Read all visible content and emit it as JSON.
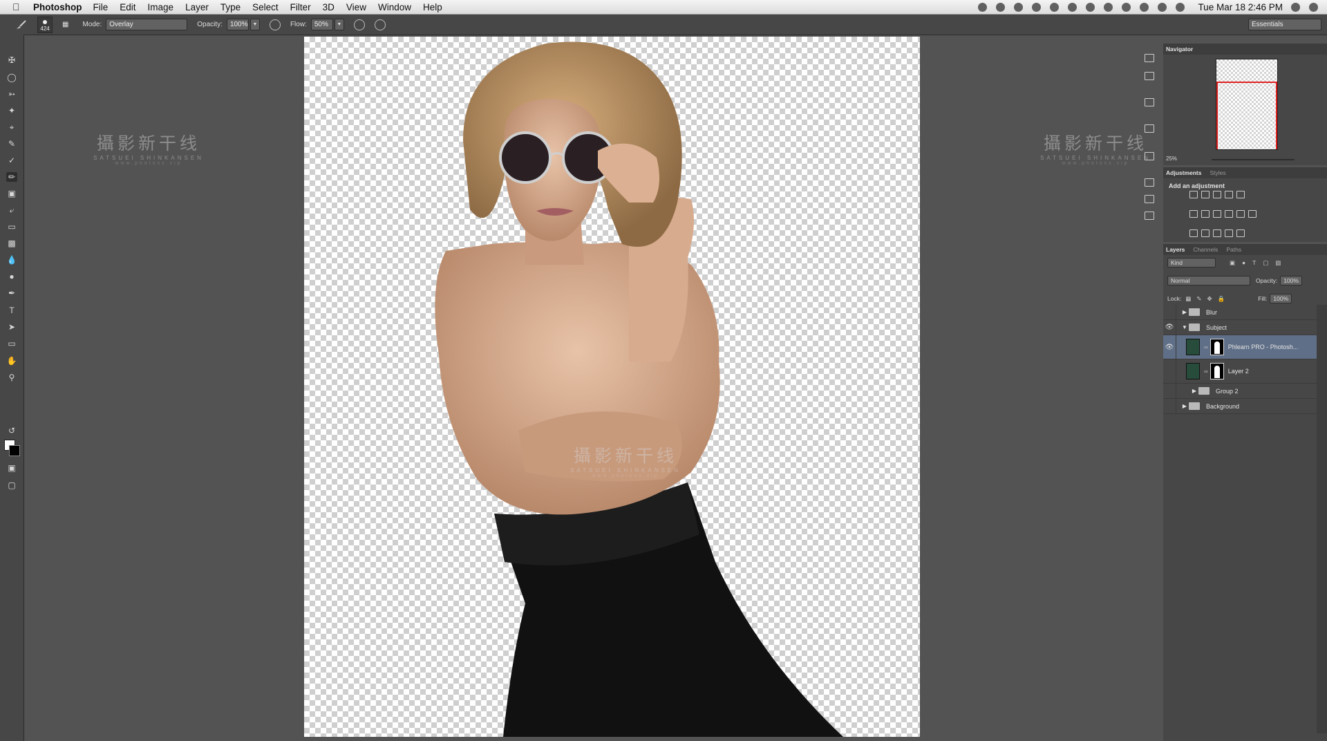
{
  "menubar": {
    "app": "Photoshop",
    "items": [
      "File",
      "Edit",
      "Image",
      "Layer",
      "Type",
      "Select",
      "Filter",
      "3D",
      "View",
      "Window",
      "Help"
    ],
    "clock": "Tue Mar 18  2:46 PM"
  },
  "options": {
    "brush_size": "424",
    "mode_label": "Mode:",
    "mode_value": "Overlay",
    "opacity_label": "Opacity:",
    "opacity_value": "100%",
    "flow_label": "Flow:",
    "flow_value": "50%",
    "workspace": "Essentials"
  },
  "navigator": {
    "tab": "Navigator",
    "zoom": "25%"
  },
  "adjustments": {
    "tabs": [
      "Adjustments",
      "Styles"
    ],
    "title": "Add an adjustment"
  },
  "layers": {
    "tabs": [
      "Layers",
      "Channels",
      "Paths"
    ],
    "kind": "Kind",
    "blend": "Normal",
    "opacity_label": "Opacity:",
    "opacity_value": "100%",
    "lock_label": "Lock:",
    "fill_label": "Fill:",
    "fill_value": "100%",
    "items": [
      {
        "name": "Blur"
      },
      {
        "name": "Subject"
      },
      {
        "name": "Phlearn PRO - Photosh..."
      },
      {
        "name": "Layer 2"
      },
      {
        "name": "Group 2"
      },
      {
        "name": "Background"
      }
    ]
  },
  "watermark": {
    "title": "攝影新干线",
    "subtitle": "SATSUEI SHINKANSEN",
    "url": "www.photoss.vip"
  },
  "colors": {
    "selected_layer": "#5f6f87",
    "ui_bg": "#535353",
    "panel_bg": "#474747"
  }
}
